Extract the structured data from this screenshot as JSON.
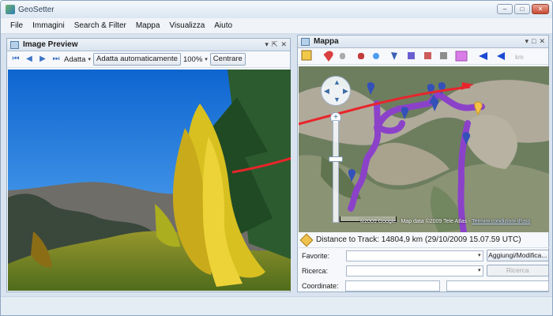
{
  "app": {
    "title": "GeoSetter"
  },
  "window_buttons": {
    "minimize": "–",
    "maximize": "□",
    "close": "✕"
  },
  "menu": [
    "File",
    "Immagini",
    "Search & Filter",
    "Mappa",
    "Visualizza",
    "Aiuto"
  ],
  "image_preview": {
    "title": "Image Preview",
    "panel_controls": [
      "▾",
      "⇱",
      "✕"
    ],
    "nav_icons": {
      "first": "⏮",
      "prev": "◀",
      "next": "▶",
      "last": "⏭"
    },
    "adapt_label": "Adatta",
    "auto_adapt_button": "Adatta automaticamente",
    "zoom_value": "100%",
    "center_button": "Centrare"
  },
  "map_panel": {
    "title": "Mappa",
    "panel_controls": [
      "▾",
      "□",
      "✕"
    ],
    "copyright": "©2009 Google - Map data ©2009 Tele Atlas -",
    "terms_link": "Termini condizioni d'uso",
    "distance_text": "Distance to Track: 14804,9 km (29/10/2009 15.07.59 UTC)",
    "favorite_label": "Favorite:",
    "add_modify_button": "Aggiungi/Modifica...",
    "search_label": "Ricerca:",
    "search_button": "Ricerca",
    "coords_label": "Coordinate:",
    "dropdown_glyph": "▾"
  },
  "icons": {
    "pencil": "pencil-icon",
    "zoom_plus": "+"
  },
  "colors": {
    "track": "#8b42c9",
    "arrow": "#e8252b",
    "pin": "#3450b9",
    "selected_pin": "#f3c34a"
  }
}
